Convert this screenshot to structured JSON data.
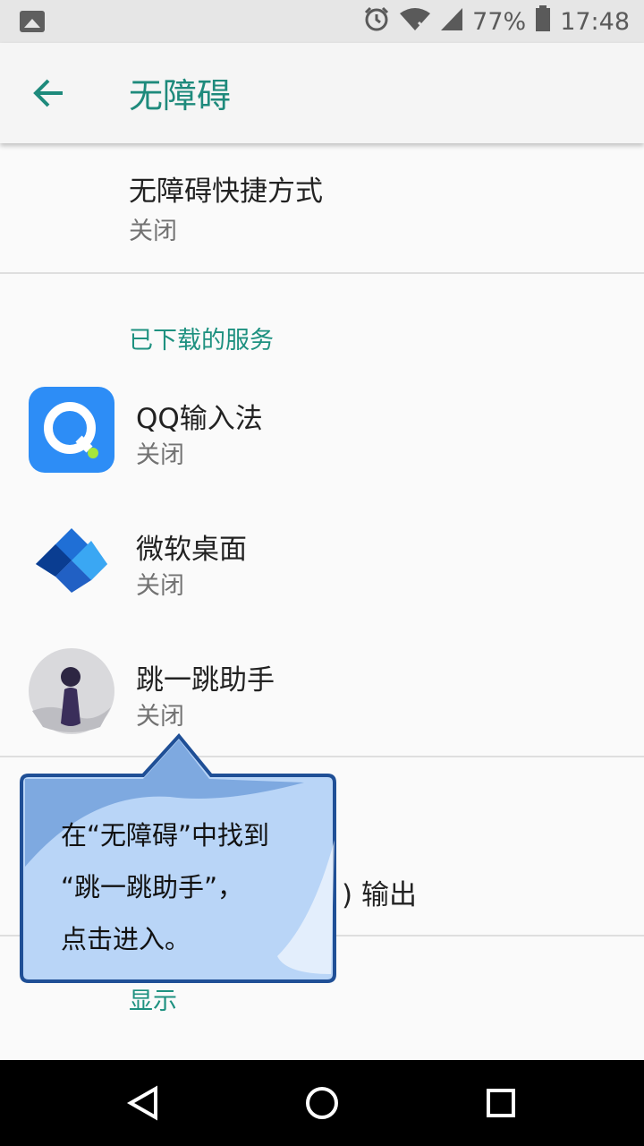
{
  "status_bar": {
    "battery": "77%",
    "time": "17:48"
  },
  "app_bar": {
    "title": "无障碍"
  },
  "shortcut": {
    "title": "无障碍快捷方式",
    "summary": "关闭"
  },
  "downloaded_section": {
    "header": "已下载的服务"
  },
  "services": [
    {
      "name": "QQ输入法",
      "status": "关闭",
      "icon": "qq-input-icon"
    },
    {
      "name": "微软桌面",
      "status": "关闭",
      "icon": "microsoft-launcher-icon"
    },
    {
      "name": "跳一跳助手",
      "status": "关闭",
      "icon": "jump-helper-icon"
    }
  ],
  "partial_row": {
    "text": ") 输出"
  },
  "display_section": {
    "header": "显示"
  },
  "tooltip": {
    "lines": [
      "在“无障碍”中找到",
      "“跳一跳助手”，",
      "点击进入。"
    ]
  },
  "colors": {
    "accent": "#1e8a7c",
    "tooltip_fill": "#b9d5f7",
    "tooltip_border": "#1f4f96"
  }
}
